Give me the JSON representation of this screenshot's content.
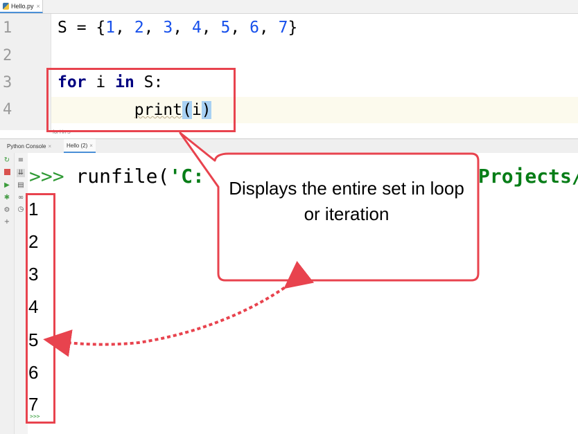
{
  "editor_tab": {
    "filename": "Hello.py",
    "close": "×"
  },
  "code": {
    "line_numbers": [
      "1",
      "2",
      "3",
      "4"
    ],
    "line1": {
      "var": "S",
      "eq": " = {",
      "n1": "1",
      "c1": ", ",
      "n2": "2",
      "c2": ", ",
      "n3": "3",
      "c3": ", ",
      "n4": "4",
      "c4": ", ",
      "n5": "5",
      "c5": ", ",
      "n6": "6",
      "c6": ", ",
      "n7": "7",
      "close": "}"
    },
    "line3": {
      "kw_for": "for",
      "mid": " i ",
      "kw_in": "in",
      "tail": " S:"
    },
    "line4": {
      "indent": "        ",
      "func": "print",
      "lparen": "(",
      "arg": "i",
      "rparen": ")"
    }
  },
  "breadcrumb": "for i in S",
  "console_tabs": [
    {
      "label": "Python Console",
      "close": "×"
    },
    {
      "label": "Hello (2)",
      "close": "×"
    }
  ],
  "console": {
    "prompt": ">>>",
    "command": " runfile(",
    "string_start": "'C:",
    "string_tail": "Projects/",
    "output": [
      "1",
      "2",
      "3",
      "4",
      "5",
      "6",
      "7"
    ],
    "bottom_prompt": ">>>"
  },
  "callout": {
    "text": "Displays the entire set in loop or iteration"
  },
  "colors": {
    "annotation_red": "#e8434e",
    "keyword": "#000080",
    "number": "#1750eb",
    "string": "#067d17",
    "prompt": "#2f9a35"
  }
}
